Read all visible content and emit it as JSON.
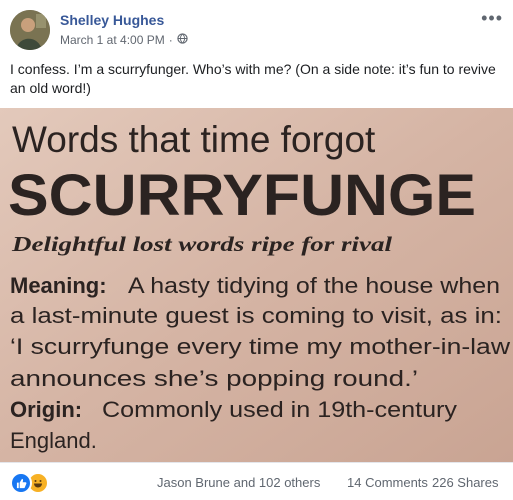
{
  "post": {
    "author": "Shelley Hughes",
    "timestamp": "March 1 at 4:00 PM",
    "separator": "·",
    "privacy_icon": "globe-icon",
    "more_label": "•••",
    "text": "I confess. I’m a scurryfunger. Who’s with me? (On a side note: it’s fun to revive an old word!)"
  },
  "clipping": {
    "heading": "Words that time forgot",
    "word": "SCURRYFUNGE",
    "subtitle": "Delightful lost words ripe for rival",
    "meaning_label": "Meaning:",
    "meaning_line1": "A hasty tidying of the house when",
    "meaning_line2": "a last-minute guest is coming to visit, as in:",
    "quote_line1": "‘I scurryfunge every time my mother-in-law",
    "quote_line2": "announces she’s popping round.’",
    "origin_label": "Origin:",
    "origin_line1": "Commonly used in 19th-century",
    "origin_line2": "England."
  },
  "footer": {
    "reactions": [
      "like-icon",
      "haha-icon"
    ],
    "reacted_by": "Jason Brune and 102 others",
    "comments": "14 Comments",
    "shares": "226 Shares"
  },
  "colors": {
    "author": "#385898",
    "meta": "#616770",
    "paper": "#d8b9a9",
    "ink": "#2b2321",
    "like": "#1877f2",
    "haha": "#f7b125"
  }
}
